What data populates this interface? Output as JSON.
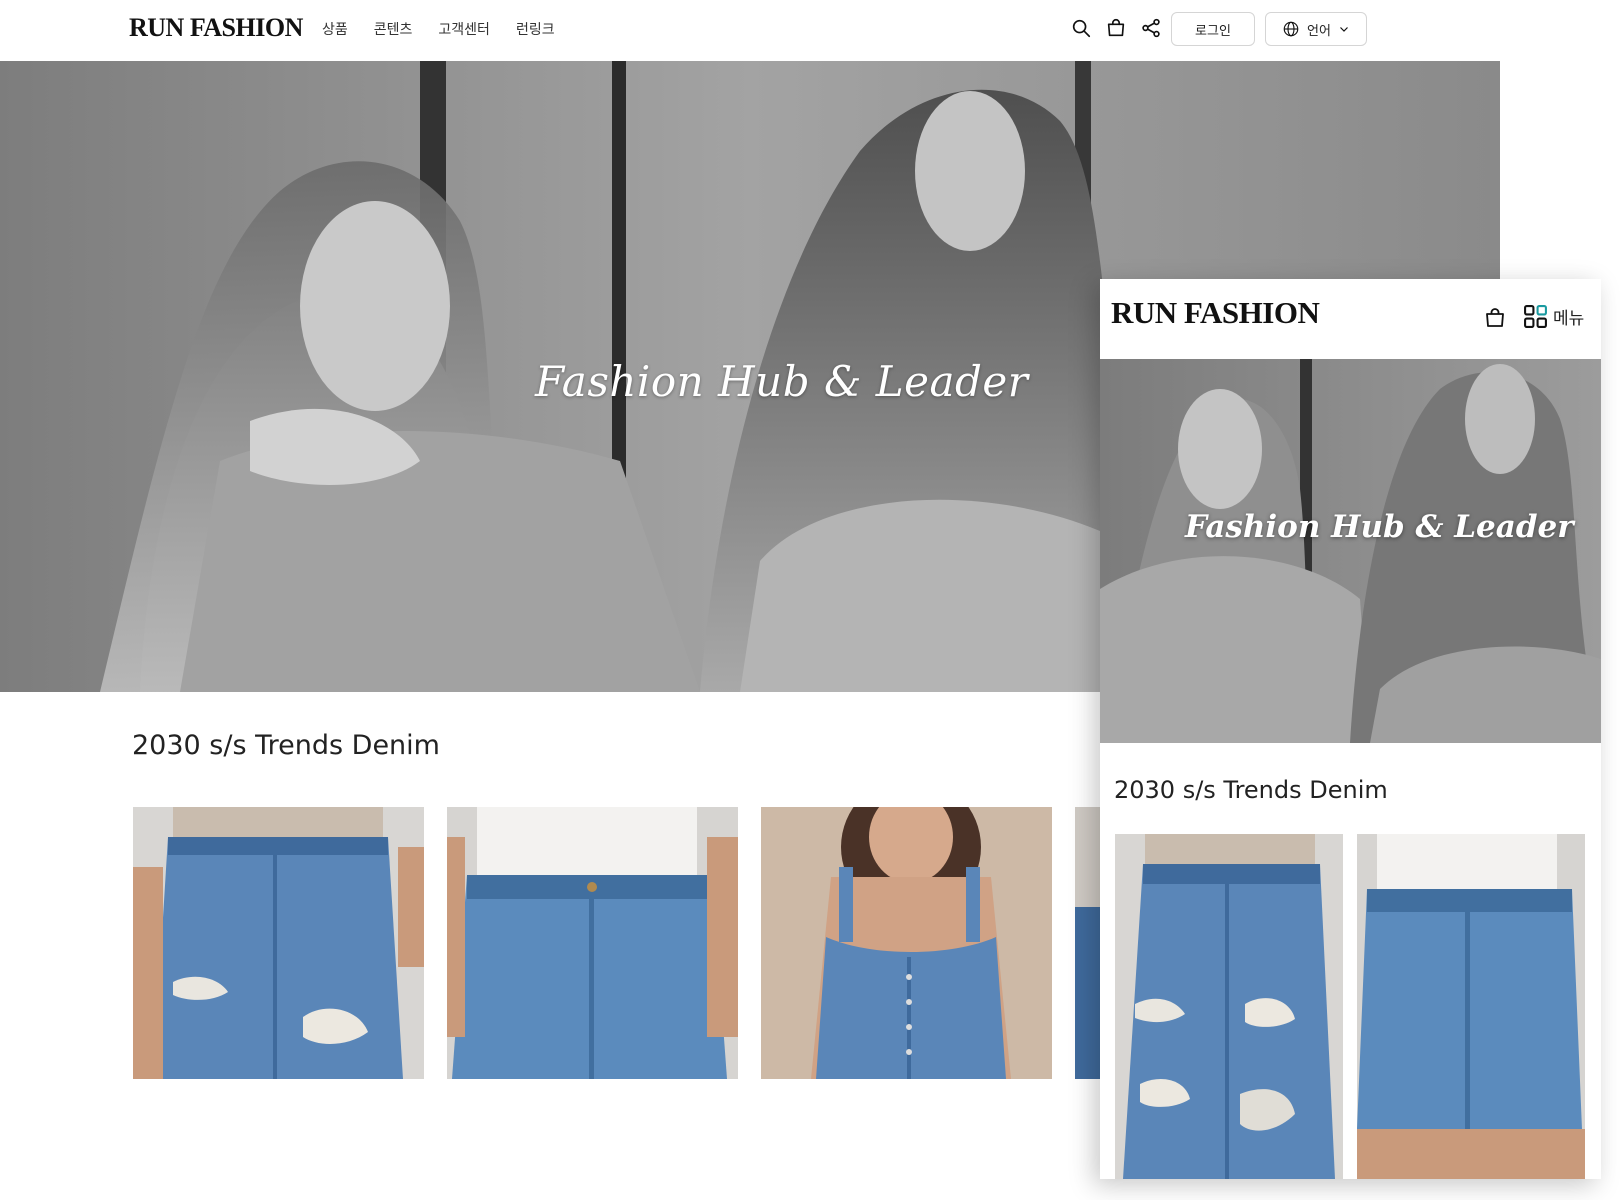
{
  "desktop": {
    "brand": "RUN FASHION",
    "nav": [
      "상품",
      "콘텐츠",
      "고객센터",
      "런링크"
    ],
    "icons": [
      "search-icon",
      "bag-icon",
      "share-icon"
    ],
    "login_label": "로그인",
    "language_label": "언어",
    "hero_title": "Fashion Hub & Leader",
    "section_title": "2030 s/s Trends Denim",
    "products": [
      "ripped-jeans",
      "high-waist-jeans",
      "denim-overall-top",
      "denim-partial"
    ]
  },
  "mobile": {
    "brand": "RUN FASHION",
    "menu_label": "메뉴",
    "hero_title": "Fashion Hub & Leader",
    "section_title": "2030 s/s Trends Denim",
    "products": [
      "ripped-jeans",
      "denim-shorts"
    ]
  },
  "colors": {
    "denim": "#5a86b8",
    "denim_dark": "#3f6a9c",
    "hero_gray": "#8e8e8e",
    "menu_icon_accent": "#1a9aa0"
  }
}
